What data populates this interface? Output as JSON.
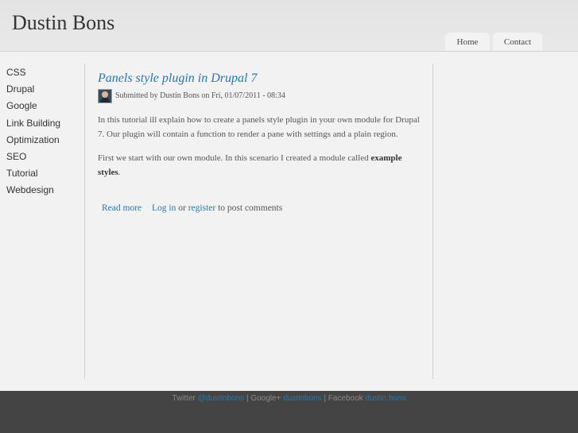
{
  "site": {
    "title": "Dustin Bons"
  },
  "nav": {
    "tabs": [
      {
        "label": "Home"
      },
      {
        "label": "Contact"
      }
    ]
  },
  "sidebar": {
    "items": [
      {
        "label": "CSS"
      },
      {
        "label": "Drupal"
      },
      {
        "label": "Google"
      },
      {
        "label": "Link Building"
      },
      {
        "label": "Optimization"
      },
      {
        "label": "SEO"
      },
      {
        "label": "Tutorial"
      },
      {
        "label": "Webdesign"
      }
    ]
  },
  "post": {
    "title": "Panels style plugin in Drupal 7",
    "submitted_prefix": "Submitted by ",
    "author": "Dustin Bons",
    "submitted_on": " on Fri, 01/07/2011 - 08:34",
    "paragraph1": "In this tutorial ill explain how to create a panels style plugin in your own module for Drupal 7. Our plugin will contain a function to render a pane with settings and a plain region.",
    "paragraph2_text": "First we start with our own module. In this scenario I created a module called ",
    "paragraph2_strong": "example styles",
    "paragraph2_end": ".",
    "read_more": "Read more",
    "login": "Log in",
    "or": " or ",
    "register": "register",
    "to_post": " to post comments"
  },
  "footer": {
    "twitter_label": "Twitter ",
    "twitter_handle": "@dustinbons",
    "sep1": " | Google+ ",
    "google_handle": "dustinbons",
    "sep2": " | Facebook ",
    "facebook_handle": "dustin.bons"
  }
}
